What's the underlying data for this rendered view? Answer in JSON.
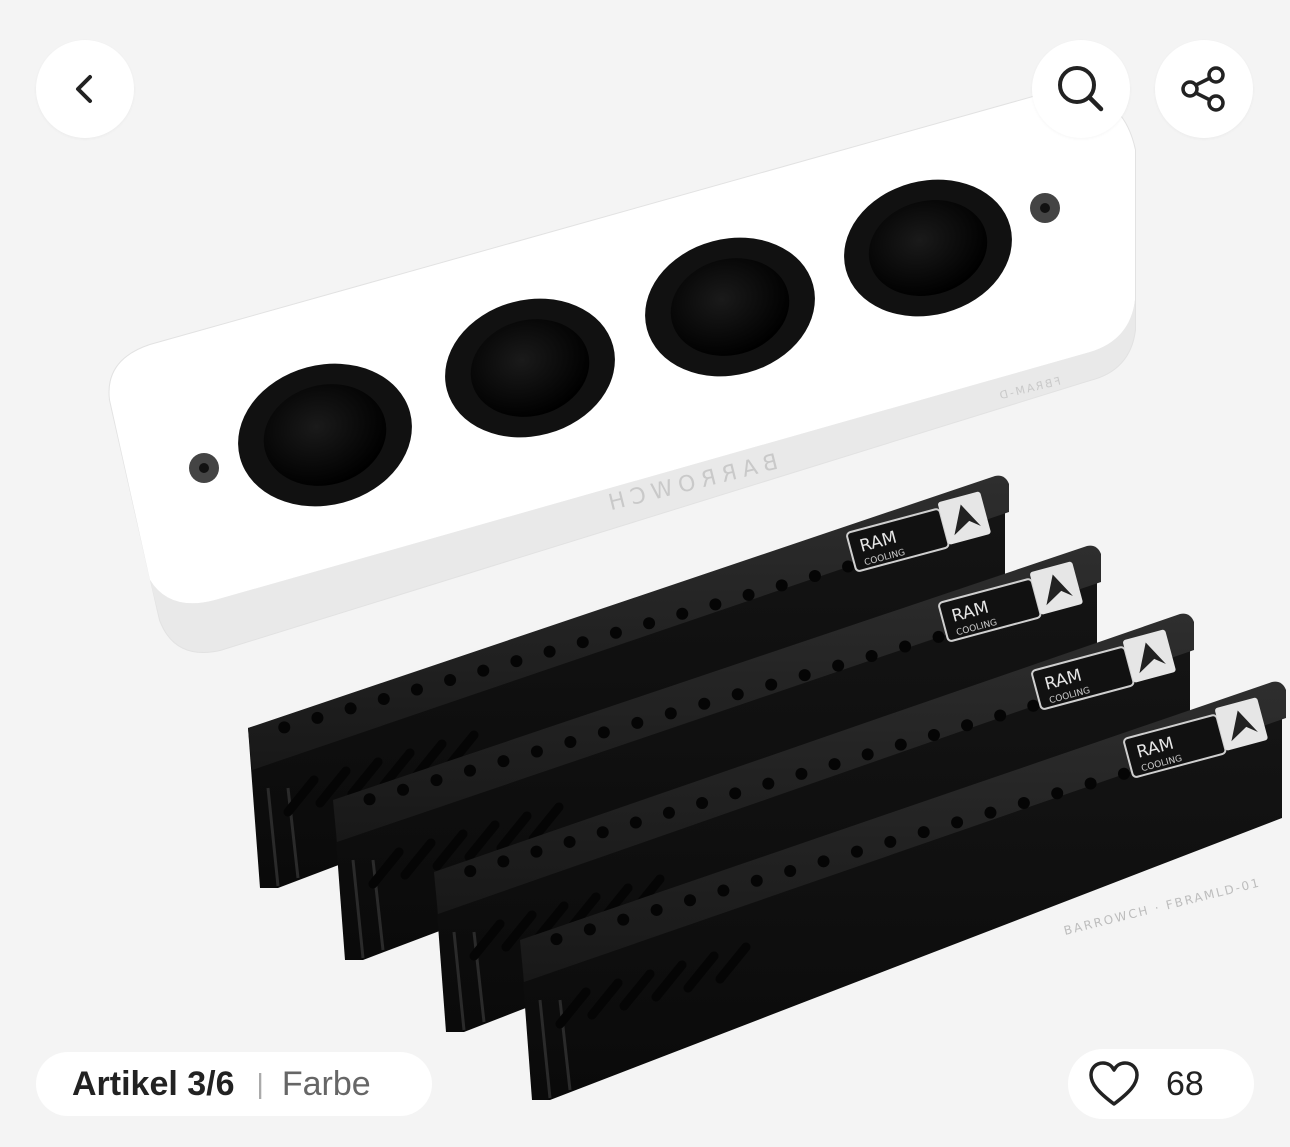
{
  "gallery": {
    "counter_label": "Artikel 3/6",
    "separator": "|",
    "attribute_label": "Farbe",
    "like_count": "68"
  },
  "icons": {
    "back": "chevron-left-icon",
    "search": "search-icon",
    "share": "share-icon",
    "like": "heart-outline-icon"
  },
  "product_image": {
    "top_brand": "BARROWCH",
    "top_model": "FBRAM-D",
    "module_label": "RAM",
    "module_sublabel": "COOLING",
    "bottom_brand": "BARROWCH · FBRAMLD-01"
  }
}
